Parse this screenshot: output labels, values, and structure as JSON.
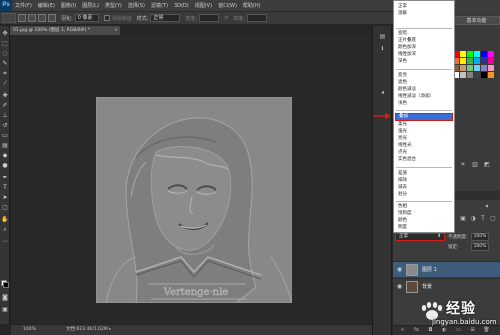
{
  "menu": {
    "items": [
      "文件(F)",
      "编辑(E)",
      "图像(I)",
      "图层(L)",
      "类型(Y)",
      "选择(S)",
      "滤镜(T)",
      "3D(D)",
      "视图(V)",
      "窗口(W)",
      "帮助(H)"
    ]
  },
  "options": {
    "feather_label": "羽化:",
    "feather_value": "0 像素",
    "antialias_label": "消除锯齿",
    "style_label": "样式:",
    "style_value": "正常",
    "width_label": "宽度:",
    "height_label": "高度:"
  },
  "document": {
    "tab_title": "01.jpg @ 100% (图层 1, RGB/8#) *",
    "close_glyph": "×"
  },
  "status": {
    "zoom": "100%",
    "doc_info": "文档:623.4K/1.62M",
    "arrow": "▸"
  },
  "workspace_preset": "基本功能",
  "layers": {
    "blend_mode": "正常",
    "opacity_label": "不透明度:",
    "opacity_value": "100%",
    "lock_label": "锁定:",
    "fill_value": "100%",
    "rows": [
      {
        "name": "图层 1",
        "active": true
      },
      {
        "name": "背景",
        "active": false
      }
    ]
  },
  "blend_modes": {
    "groups": [
      [
        "正常",
        "溶解"
      ],
      [
        "变暗",
        "正片叠底",
        "颜色加深",
        "线性加深",
        "深色"
      ],
      [
        "变亮",
        "滤色",
        "颜色减淡",
        "线性减淡（添加）",
        "浅色"
      ],
      [
        "叠加",
        "柔光",
        "强光",
        "亮光",
        "线性光",
        "点光",
        "实色混合"
      ],
      [
        "差值",
        "排除",
        "减去",
        "划分"
      ],
      [
        "色相",
        "饱和度",
        "颜色",
        "明度"
      ]
    ],
    "highlighted": "叠加"
  },
  "photo": {
    "shirt_text": "Vertenge·nle"
  },
  "watermark": {
    "text": "经验",
    "url": "jingyan.baidu.com"
  },
  "colors": {
    "highlight": "#3a6fd8",
    "annotation_red": "#d01b1b",
    "foreground": "#ffffff",
    "background": "#000000"
  }
}
